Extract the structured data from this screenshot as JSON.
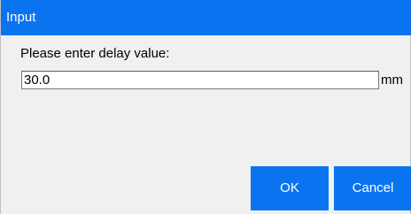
{
  "dialog": {
    "title": "Input",
    "prompt": "Please enter delay value:",
    "value": "30.0",
    "unit": "mm",
    "ok_label": "OK",
    "cancel_label": "Cancel"
  },
  "colors": {
    "accent": "#0a74f0",
    "background": "#f0f0f0"
  }
}
